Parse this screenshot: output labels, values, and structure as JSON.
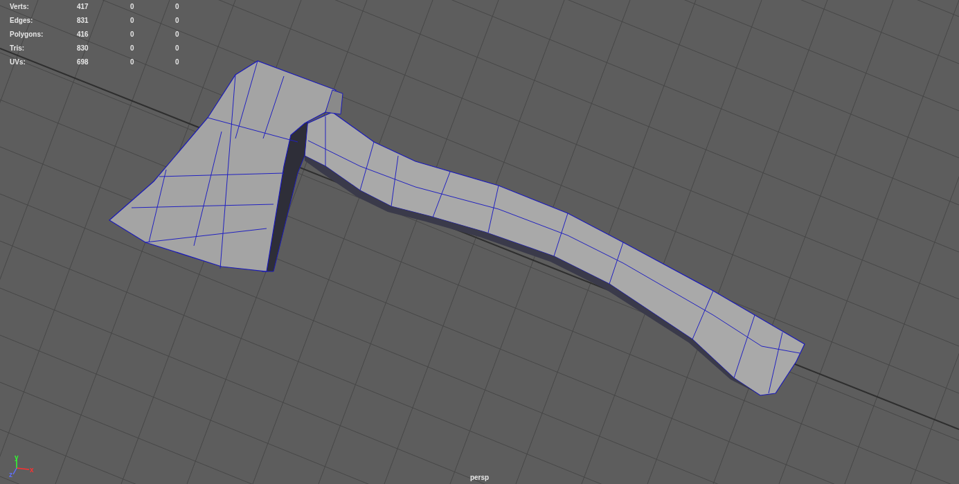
{
  "stats": [
    {
      "label": "Verts:",
      "values": [
        "417",
        "0",
        "0"
      ]
    },
    {
      "label": "Edges:",
      "values": [
        "831",
        "0",
        "0"
      ]
    },
    {
      "label": "Polygons:",
      "values": [
        "416",
        "0",
        "0"
      ]
    },
    {
      "label": "Tris:",
      "values": [
        "830",
        "0",
        "0"
      ]
    },
    {
      "label": "UVs:",
      "values": [
        "698",
        "0",
        "0"
      ]
    }
  ],
  "axis_gizmo": [
    "x",
    "y",
    "z"
  ],
  "camera": "persp"
}
